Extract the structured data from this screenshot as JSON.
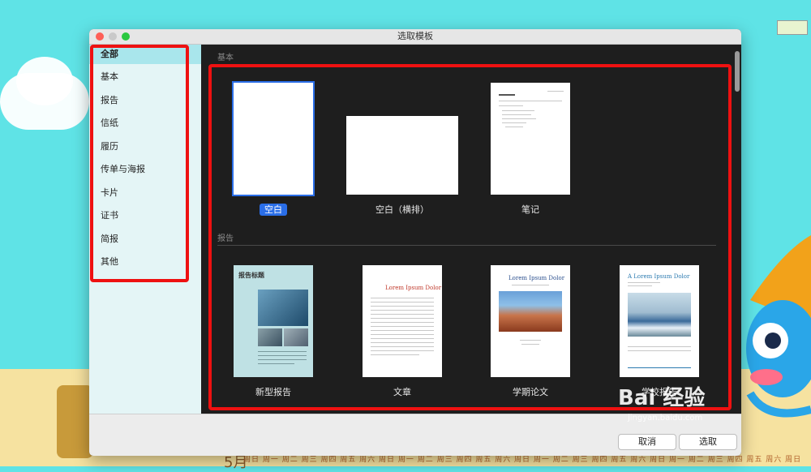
{
  "window": {
    "title": "选取模板"
  },
  "sidebar": {
    "items": [
      {
        "label": "全部",
        "selected": true
      },
      {
        "label": "基本",
        "selected": false
      },
      {
        "label": "报告",
        "selected": false
      },
      {
        "label": "信纸",
        "selected": false
      },
      {
        "label": "履历",
        "selected": false
      },
      {
        "label": "传单与海报",
        "selected": false
      },
      {
        "label": "卡片",
        "selected": false
      },
      {
        "label": "证书",
        "selected": false
      },
      {
        "label": "简报",
        "selected": false
      },
      {
        "label": "其他",
        "selected": false
      }
    ]
  },
  "sections": {
    "basic": {
      "title": "基本",
      "templates": [
        {
          "label": "空白",
          "selected": true
        },
        {
          "label": "空白（横排）",
          "selected": false
        },
        {
          "label": "笔记",
          "selected": false
        }
      ]
    },
    "report": {
      "title": "报告",
      "templates": [
        {
          "label": "新型报告",
          "thumb_title": "报告标题"
        },
        {
          "label": "文章",
          "thumb_title": "Lorem Ipsum Dolor"
        },
        {
          "label": "学期论文",
          "thumb_title": "Lorem Ipsum Dolor"
        },
        {
          "label": "学校报告",
          "thumb_title": "A Lorem Ipsum Dolor"
        }
      ]
    }
  },
  "footer": {
    "cancel_label": "取消",
    "choose_label": "选取"
  },
  "desktop": {
    "month": "5月",
    "weekdays": "周日 周一 周二 周三 周四 周五 周六 周日 周一 周二 周三 周四 周五 周六 周日 周一 周二 周三 周四 周五 周六 周日 周一 周二 周三 周四 周五 周六 周日"
  },
  "watermark": {
    "text": "Bai 经验",
    "subtext": "jingyan.baidu.com"
  },
  "colors": {
    "accent": "#2a6ee8",
    "annotation": "#ee1111",
    "sidebar_selected": "#a9e6ec"
  }
}
